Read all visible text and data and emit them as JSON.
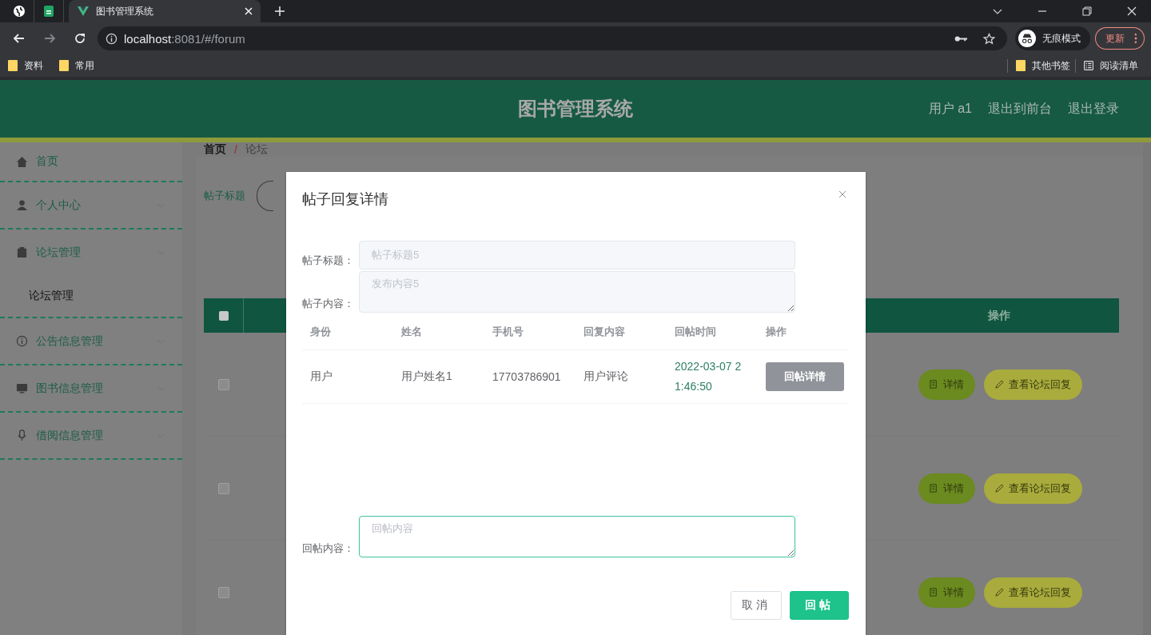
{
  "browser": {
    "tabs": [
      {
        "kind": "pinned",
        "selected": false
      },
      {
        "kind": "pinned",
        "selected": false
      },
      {
        "kind": "page",
        "title": "图书管理系统",
        "selected": true
      }
    ],
    "address": {
      "host": "localhost",
      "path": ":8081/#/forum"
    },
    "incognito_label": "无痕模式",
    "update_button": "更新",
    "bookmarks": [
      "资料",
      "常用"
    ],
    "other_bookmarks": "其他书签",
    "reading_list": "阅读清单"
  },
  "header": {
    "title": "图书管理系统",
    "links": [
      "用户 a1",
      "退出到前台",
      "退出登录"
    ]
  },
  "sidebar": {
    "items": [
      {
        "label": "首页",
        "kind": "link"
      },
      {
        "label": "个人中心",
        "kind": "menu"
      },
      {
        "label": "论坛管理",
        "kind": "menu",
        "children": [
          {
            "label": "论坛管理"
          }
        ]
      },
      {
        "label": "公告信息管理",
        "kind": "menu"
      },
      {
        "label": "图书信息管理",
        "kind": "menu"
      },
      {
        "label": "借阅信息管理",
        "kind": "menu"
      }
    ]
  },
  "breadcrumb": {
    "items": [
      "首页",
      "论坛"
    ],
    "separator": "/"
  },
  "search": {
    "label": "帖子标题"
  },
  "table": {
    "columns": [
      "操作"
    ],
    "all_checked": false,
    "rows": [
      {
        "checked": false,
        "actions": [
          "详情",
          "查看论坛回复"
        ]
      },
      {
        "checked": false,
        "actions": [
          "详情",
          "查看论坛回复"
        ]
      },
      {
        "checked": false,
        "actions": [
          "详情",
          "查看论坛回复"
        ]
      }
    ]
  },
  "dialog": {
    "title": "帖子回复详情",
    "fields": [
      {
        "label": "帖子标题：",
        "value": "帖子标题5",
        "kind": "input"
      },
      {
        "label": "帖子内容：",
        "value": "发布内容5",
        "kind": "textarea"
      }
    ],
    "replies": {
      "columns": [
        "身份",
        "姓名",
        "手机号",
        "回复内容",
        "回帖时间",
        "操作"
      ],
      "rows": [
        {
          "cells": [
            "用户",
            "用户姓名1",
            "17703786901",
            "用户评论",
            "2022-03-07 21:46:50"
          ],
          "action": "回帖详情"
        }
      ]
    },
    "reply_field": {
      "label": "回帖内容：",
      "placeholder": "回帖内容"
    },
    "buttons": [
      {
        "label": "取消",
        "kind": "secondary"
      },
      {
        "label": "回帖",
        "kind": "primary"
      }
    ]
  }
}
